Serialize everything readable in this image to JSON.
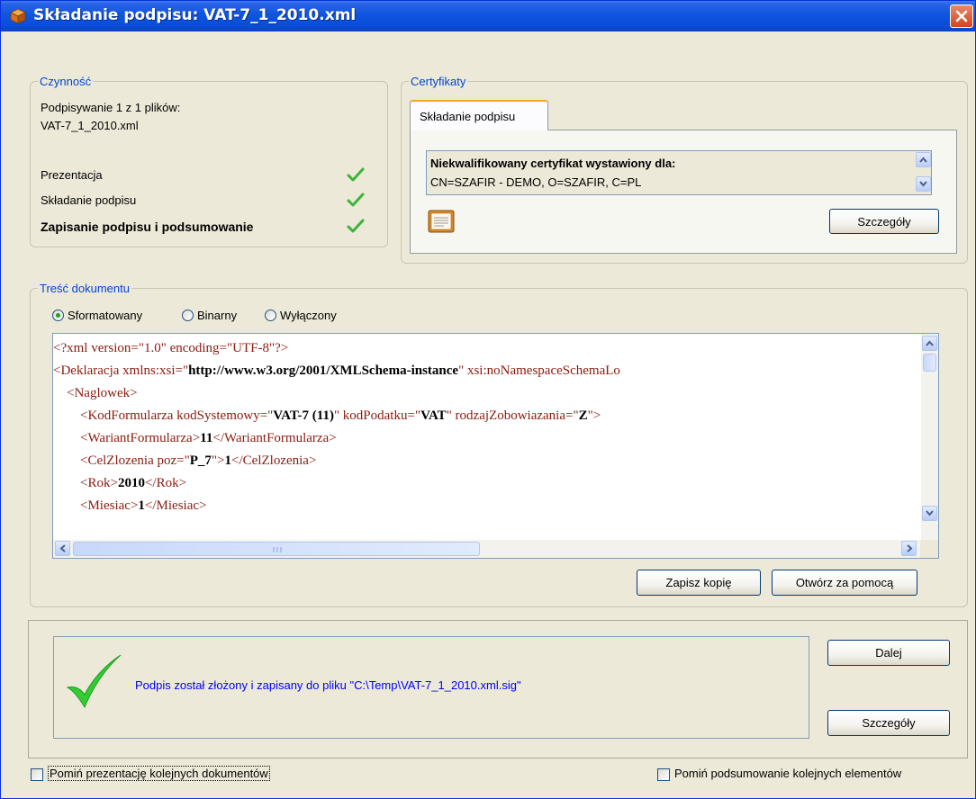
{
  "window": {
    "title": "Składanie podpisu: VAT-7_1_2010.xml",
    "title_icon": "package-icon",
    "close_icon": "close-icon"
  },
  "activity": {
    "legend": "Czynność",
    "line1": "Podpisywanie 1 z 1 plików:",
    "line2": "VAT-7_1_2010.xml",
    "steps": [
      {
        "label": "Prezentacja",
        "bold": false
      },
      {
        "label": "Składanie podpisu",
        "bold": false
      },
      {
        "label": "Zapisanie podpisu i podsumowanie",
        "bold": true
      }
    ]
  },
  "certs": {
    "legend": "Certyfikaty",
    "tab_label": "Składanie podpisu",
    "cert_title": "Niekwalifikowany certyfikat wystawiony dla:",
    "cert_subject": "CN=SZAFIR - DEMO, O=SZAFIR, C=PL",
    "details_btn": "Szczegóły",
    "cert_icon": "certificate-icon"
  },
  "document": {
    "legend": "Treść dokumentu",
    "radios": [
      {
        "label": "Sformatowany",
        "checked": true
      },
      {
        "label": "Binarny",
        "checked": false
      },
      {
        "label": "Wyłączony",
        "checked": false
      }
    ],
    "lines": [
      [
        {
          "t": "tag",
          "v": "<?xml version=\""
        },
        {
          "t": "attr",
          "v": "1.0"
        },
        {
          "t": "tag",
          "v": "\" encoding=\""
        },
        {
          "t": "attr",
          "v": "UTF-8"
        },
        {
          "t": "tag",
          "v": "\"?>"
        }
      ],
      [
        {
          "t": "tag",
          "v": "<Deklaracja xmlns:xsi=\""
        },
        {
          "t": "val",
          "v": "http://www.w3.org/2001/XMLSchema-instance"
        },
        {
          "t": "tag",
          "v": "\" xsi:noNamespaceSchemaLo"
        }
      ],
      [
        {
          "t": "tag",
          "v": "    <Naglowek>"
        }
      ],
      [
        {
          "t": "tag",
          "v": "        <KodFormularza kodSystemowy=\""
        },
        {
          "t": "val",
          "v": "VAT-7 (11)"
        },
        {
          "t": "tag",
          "v": "\" kodPodatku=\""
        },
        {
          "t": "val",
          "v": "VAT"
        },
        {
          "t": "tag",
          "v": "\" rodzajZobowiazania=\""
        },
        {
          "t": "val",
          "v": "Z"
        },
        {
          "t": "tag",
          "v": "\">"
        }
      ],
      [
        {
          "t": "tag",
          "v": "        <WariantFormularza>"
        },
        {
          "t": "txt",
          "v": "11"
        },
        {
          "t": "tag",
          "v": "</WariantFormularza>"
        }
      ],
      [
        {
          "t": "tag",
          "v": "        <CelZlozenia poz=\""
        },
        {
          "t": "val",
          "v": "P_7"
        },
        {
          "t": "tag",
          "v": "\">"
        },
        {
          "t": "txt",
          "v": "1"
        },
        {
          "t": "tag",
          "v": "</CelZlozenia>"
        }
      ],
      [
        {
          "t": "tag",
          "v": "        <Rok>"
        },
        {
          "t": "txt",
          "v": "2010"
        },
        {
          "t": "tag",
          "v": "</Rok>"
        }
      ],
      [
        {
          "t": "tag",
          "v": "        <Miesiac>"
        },
        {
          "t": "txt",
          "v": "1"
        },
        {
          "t": "tag",
          "v": "</Miesiac>"
        }
      ]
    ],
    "save_copy_btn": "Zapisz kopię",
    "open_with_btn": "Otwórz za pomocą"
  },
  "status": {
    "message": "Podpis został złożony i zapisany do pliku \"C:\\Temp\\VAT-7_1_2010.xml.sig\"",
    "next_btn": "Dalej",
    "details_btn": "Szczegóły",
    "success_icon": "big-checkmark-icon"
  },
  "footer": {
    "skip_presentation": "Pomiń prezentację kolejnych dokumentów",
    "skip_summary": "Pomiń podsumowanie kolejnych elementów"
  },
  "colors": {
    "titlebar": "#0a4ed8",
    "face": "#ECE9D8",
    "legend": "#0046d5",
    "check": "#3cb43c",
    "xml_markup": "#8b1a0e",
    "status_text": "#0000ff"
  }
}
